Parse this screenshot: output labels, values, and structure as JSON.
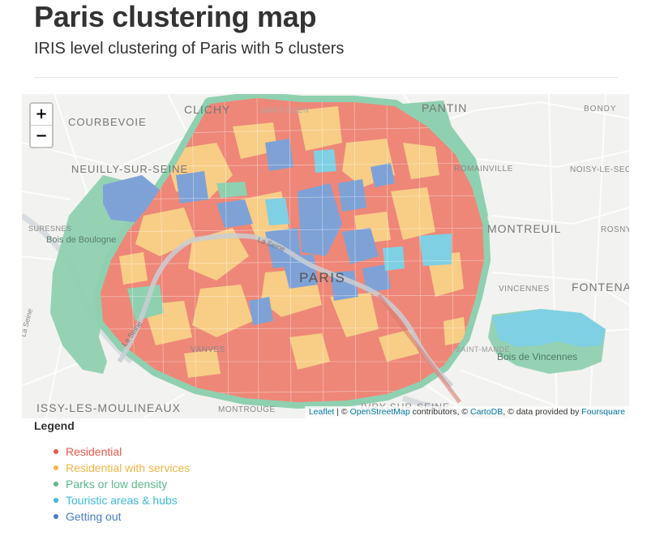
{
  "header": {
    "title": "Paris clustering map",
    "subtitle": "IRIS level clustering of Paris with 5 clusters"
  },
  "map": {
    "zoom_in_label": "+",
    "zoom_out_label": "−",
    "labels": {
      "clichy": "CLICHY",
      "saint_ouen": "SAINT-OUEN",
      "pantin": "PANTIN",
      "bondy": "BONDY",
      "courbevoie": "COURBEVOIE",
      "neuilly": "NEUILLY-SUR-SEINE",
      "romainville": "ROMAINVILLE",
      "noisy": "NOISY-LE-SEC",
      "suresnes": "SURESNES",
      "boulogne_wood": "Bois de Boulogne",
      "montreuil": "MONTREUIL",
      "rosny": "ROSNY",
      "la_seine_north": "La Seine",
      "paris": "PARIS",
      "vincennes": "VINCENNES",
      "fontenay": "FONTENA",
      "la_seine_west": "La Seine",
      "la_seine_far": "La Seine",
      "saint_mande": "SAINT-MANDÉ",
      "vincennes_wood": "Bois de Vincennes",
      "vanves": "VANVES",
      "issy": "ISSY-LES-MOULINEAUX",
      "montrouge": "MONTROUGE",
      "ivry": "IVRY-SUR-SEINE"
    },
    "attribution": {
      "leaflet": "Leaflet",
      "sep1": " | © ",
      "osm": "OpenStreetMap",
      "contrib": " contributors, © ",
      "carto": "CartoDB",
      "data": ", © data provided by ",
      "foursquare": "Foursquare"
    }
  },
  "legend": {
    "title": "Legend",
    "items": [
      {
        "label": "Residential",
        "color": "#e8594a"
      },
      {
        "label": "Residential with services",
        "color": "#f4b545"
      },
      {
        "label": "Parks or low density",
        "color": "#5cb88a"
      },
      {
        "label": "Touristic areas & hubs",
        "color": "#3fb8d8"
      },
      {
        "label": "Getting out",
        "color": "#4a7cc5"
      }
    ]
  }
}
